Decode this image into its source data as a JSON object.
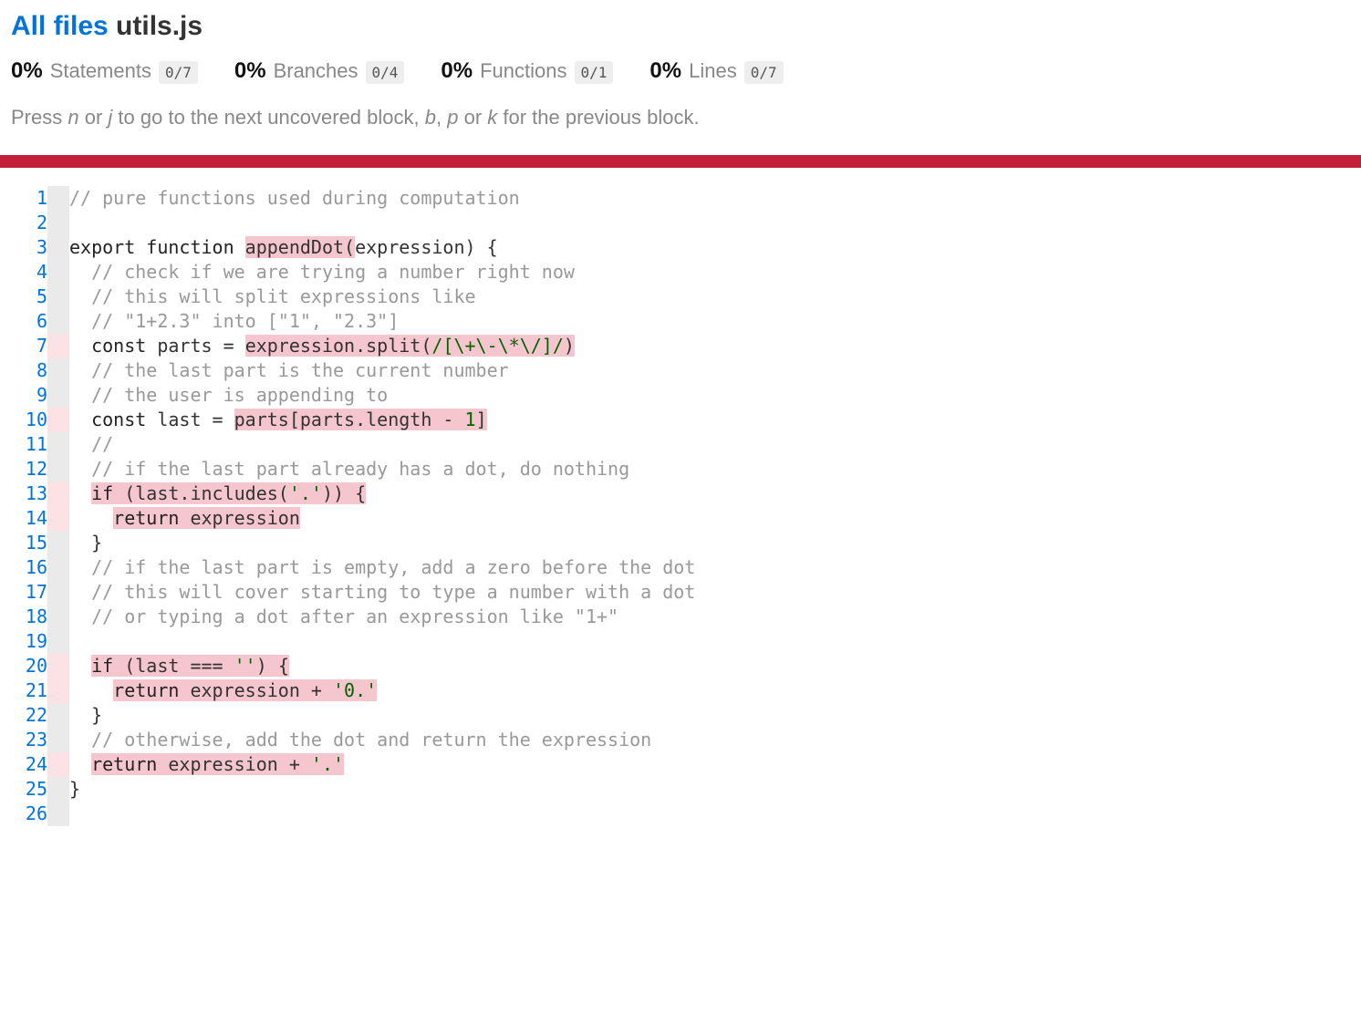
{
  "breadcrumb": {
    "root": "All files",
    "file": "utils.js"
  },
  "metrics": [
    {
      "pct": "0%",
      "label": "Statements",
      "frac": "0/7"
    },
    {
      "pct": "0%",
      "label": "Branches",
      "frac": "0/4"
    },
    {
      "pct": "0%",
      "label": "Functions",
      "frac": "0/1"
    },
    {
      "pct": "0%",
      "label": "Lines",
      "frac": "0/7"
    }
  ],
  "hint": {
    "p1": "Press ",
    "k1": "n",
    "p2": " or ",
    "k2": "j",
    "p3": " to go to the next uncovered block, ",
    "k3": "b",
    "p4": ", ",
    "k4": "p",
    "p5": " or ",
    "k5": "k",
    "p6": " for the previous block."
  },
  "code": {
    "lineCount": 26,
    "gutter": [
      "neutral",
      "neutral",
      "neutral",
      "neutral",
      "neutral",
      "neutral",
      "no",
      "neutral",
      "neutral",
      "no",
      "neutral",
      "neutral",
      "no",
      "no",
      "neutral",
      "neutral",
      "neutral",
      "neutral",
      "neutral",
      "no",
      "no",
      "neutral",
      "neutral",
      "no",
      "neutral",
      "neutral"
    ],
    "lines": {
      "l1_c1": "// pure functions used during computation",
      "l3_export": "export",
      "l3_function": "function",
      "l3_name": "appendDot",
      "l3_open": "(",
      "l3_arg": "expression",
      "l3_close": ") {",
      "l4_c": "// check if we are trying a number right now",
      "l5_c": "// this will split expressions like",
      "l6_c": "// \"1+2.3\" into [\"1\", \"2.3\"]",
      "l7_const": "const",
      "l7_parts": " parts = ",
      "l7_expr": "expression.split(",
      "l7_regex": "/[\\+\\-\\*\\/]/",
      "l7_end": ")",
      "l8_c": "// the last part is the current number",
      "l9_c": "// the user is appending to",
      "l10_const": "const",
      "l10_last": " last = ",
      "l10_expr": "parts[parts.length - ",
      "l10_one": "1",
      "l10_end": "]",
      "l11_c": "//",
      "l12_c": "// if the last part already has a dot, do nothing",
      "l13_if": "if",
      "l13_cond": " (last.includes(",
      "l13_str": "'.'",
      "l13_end": ")) {",
      "l14_return": "return",
      "l14_expr": " expression",
      "l15_close": "}",
      "l16_c": "// if the last part is empty, add a zero before the dot",
      "l17_c": "// this will cover starting to type a number with a dot",
      "l18_c": "// or typing a dot after an expression like \"1+\"",
      "l20_if": "if",
      "l20_cond": " (last === ",
      "l20_str": "''",
      "l20_end": ") {",
      "l21_return": "return",
      "l21_expr": " expression + ",
      "l21_str": "'0.'",
      "l22_close": "}",
      "l23_c": "// otherwise, add the dot and return the expression",
      "l24_return": "return",
      "l24_expr": " expression + ",
      "l24_str": "'.'",
      "l25_close": "}"
    }
  }
}
